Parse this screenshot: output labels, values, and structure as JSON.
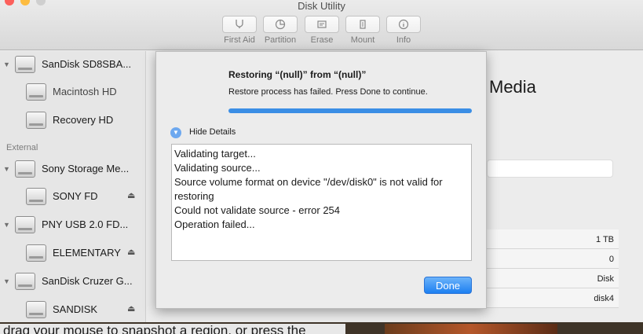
{
  "window": {
    "title": "Disk Utility"
  },
  "toolbar": {
    "buttons": [
      {
        "label": "First Aid",
        "icon": "stethoscope-icon"
      },
      {
        "label": "Partition",
        "icon": "pie-icon"
      },
      {
        "label": "Erase",
        "icon": "eraser-icon"
      },
      {
        "label": "Mount",
        "icon": "mount-icon"
      },
      {
        "label": "Info",
        "icon": "info-icon"
      }
    ]
  },
  "sidebar": {
    "internal": [
      {
        "label": "SanDisk SD8SBA..."
      },
      {
        "label": "Macintosh HD"
      },
      {
        "label": "Recovery HD"
      }
    ],
    "section_external": "External",
    "external": [
      {
        "label": "Sony Storage Me..."
      },
      {
        "label": "SONY FD"
      },
      {
        "label": "PNY USB 2.0 FD..."
      },
      {
        "label": "ELEMENTARY"
      },
      {
        "label": "SanDisk Cruzer G..."
      },
      {
        "label": "SANDISK"
      }
    ]
  },
  "main": {
    "heading": "Media",
    "info_values": [
      "1 TB",
      "0",
      "Disk",
      "disk4"
    ]
  },
  "dialog": {
    "title": "Restoring “(null)” from “(null)”",
    "message": "Restore process has failed. Press Done to continue.",
    "progress": 1.0,
    "details_toggle": "Hide Details",
    "log": [
      "Validating target...",
      "Validating source...",
      "Source volume format on device \"/dev/disk0\" is not valid for restoring",
      "Could not validate source - error 254",
      "Operation failed..."
    ],
    "done_label": "Done"
  },
  "overlay_text": "drag your mouse to snapshot a region, or press the",
  "colors": {
    "accent": "#3b8ee5",
    "done_button": "#1c7ff1"
  }
}
